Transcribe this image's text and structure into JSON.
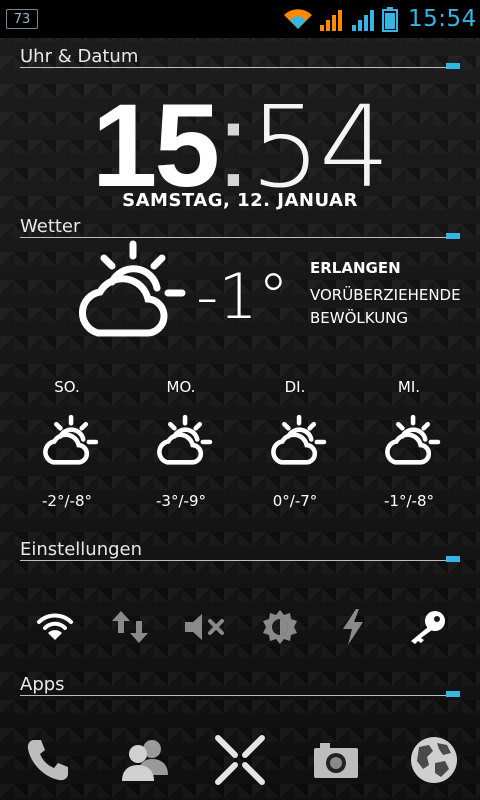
{
  "status_bar": {
    "notification": "73",
    "time": "15:54"
  },
  "sections": {
    "clock": "Uhr & Datum",
    "weather": "Wetter",
    "settings": "Einstellungen",
    "apps": "Apps"
  },
  "clock": {
    "hour": "15",
    "separator": ":",
    "minute": "54",
    "date": "SAMSTAG, 12. JANUAR"
  },
  "weather": {
    "current_temp": "-1°",
    "city": "ERLANGEN",
    "condition": "VORÜBERZIEHENDE BEWÖLKUNG",
    "forecast": [
      {
        "day": "SO.",
        "range": "-2°/-8°"
      },
      {
        "day": "MO.",
        "range": "-3°/-9°"
      },
      {
        "day": "DI.",
        "range": "0°/-7°"
      },
      {
        "day": "MI.",
        "range": "-1°/-8°"
      }
    ]
  },
  "settings_toggles": [
    "wifi-icon",
    "data-sync-icon",
    "mute-icon",
    "brightness-icon",
    "power-icon",
    "key-icon"
  ],
  "apps": [
    "phone-icon",
    "contacts-icon",
    "app-drawer-icon",
    "camera-icon",
    "browser-icon"
  ],
  "colors": {
    "accent": "#33b5e5",
    "signal": "#ff8a00"
  }
}
